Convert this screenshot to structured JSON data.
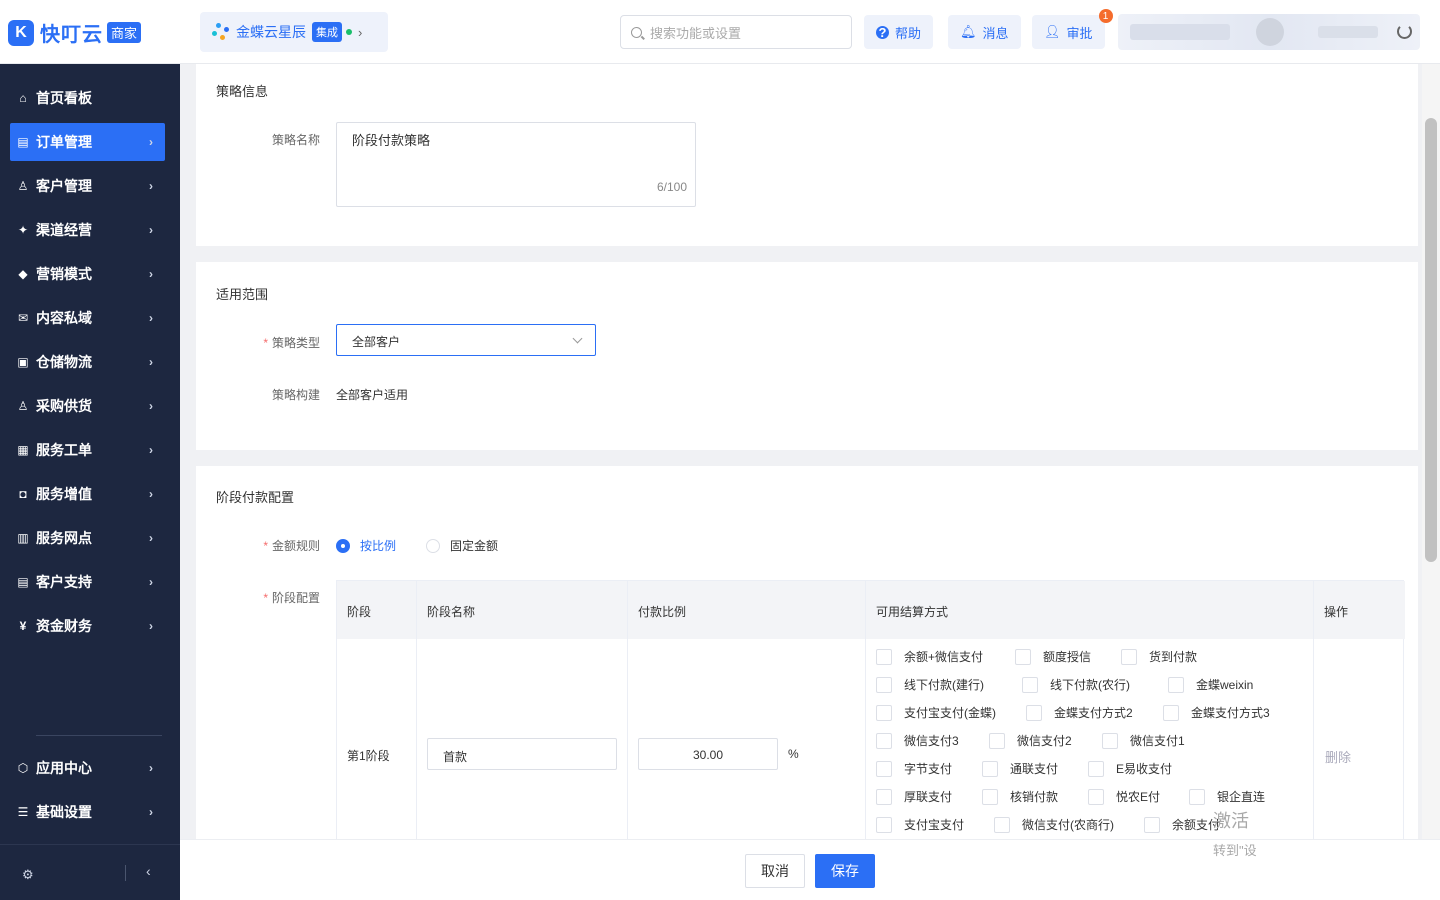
{
  "header": {
    "logo_text": "快叮云",
    "logo_badge": "商家",
    "brand_name": "金蝶云星辰",
    "brand_tag": "集成",
    "search_placeholder": "搜索功能或设置",
    "help_label": "帮助",
    "messages_label": "消息",
    "approval_label": "审批",
    "approval_badge": "1"
  },
  "sidebar": {
    "items": [
      {
        "label": "首页看板",
        "icon": "home-icon"
      },
      {
        "label": "订单管理",
        "icon": "order-icon",
        "active": true
      },
      {
        "label": "客户管理",
        "icon": "customer-icon"
      },
      {
        "label": "渠道经营",
        "icon": "channel-icon"
      },
      {
        "label": "营销模式",
        "icon": "marketing-icon"
      },
      {
        "label": "内容私域",
        "icon": "mail-icon"
      },
      {
        "label": "仓储物流",
        "icon": "warehouse-icon"
      },
      {
        "label": "采购供货",
        "icon": "purchase-icon"
      },
      {
        "label": "服务工单",
        "icon": "ticket-icon"
      },
      {
        "label": "服务增值",
        "icon": "bag-icon"
      },
      {
        "label": "服务网点",
        "icon": "store-icon"
      },
      {
        "label": "客户支持",
        "icon": "support-icon"
      },
      {
        "label": "资金财务",
        "icon": "finance-icon"
      }
    ],
    "bottom_items": [
      {
        "label": "应用中心",
        "icon": "app-center-icon"
      },
      {
        "label": "基础设置",
        "icon": "settings-list-icon"
      }
    ]
  },
  "strategy_info": {
    "section_title": "策略信息",
    "name_label": "策略名称",
    "name_value": "阶段付款策略",
    "name_count": "6/100"
  },
  "scope": {
    "section_title": "适用范围",
    "type_label": "策略类型",
    "type_value": "全部客户",
    "build_label": "策略构建",
    "build_value": "全部客户适用"
  },
  "stage_config": {
    "section_title": "阶段付款配置",
    "amount_rule_label": "金额规则",
    "rule_options": [
      "按比例",
      "固定金额"
    ],
    "rule_selected": "按比例",
    "stage_label": "阶段配置",
    "columns": [
      "阶段",
      "阶段名称",
      "付款比例",
      "可用结算方式",
      "操作"
    ],
    "rows": [
      {
        "stage": "第1阶段",
        "stage_name": "首款",
        "ratio": "30.00",
        "ratio_unit": "%",
        "action": "删除",
        "payment_methods": [
          [
            "余额+微信支付",
            "额度授信",
            "货到付款"
          ],
          [
            "线下付款(建行)",
            "线下付款(农行)",
            "金蝶weixin"
          ],
          [
            "支付宝支付(金蝶)",
            "金蝶支付方式2",
            "金蝶支付方式3"
          ],
          [
            "微信支付3",
            "微信支付2",
            "微信支付1"
          ],
          [
            "字节支付",
            "通联支付",
            "E易收支付"
          ],
          [
            "厚联支付",
            "核销付款",
            "悦农E付",
            "银企直连"
          ],
          [
            "支付宝支付",
            "微信支付(农商行)",
            "余额支付"
          ]
        ]
      }
    ]
  },
  "footer": {
    "cancel_label": "取消",
    "save_label": "保存",
    "watermark_line1": "激活",
    "watermark_line2": "转到\"设"
  },
  "colors": {
    "accent": "#2b6ff5",
    "sidebar_bg": "#1d2740"
  }
}
